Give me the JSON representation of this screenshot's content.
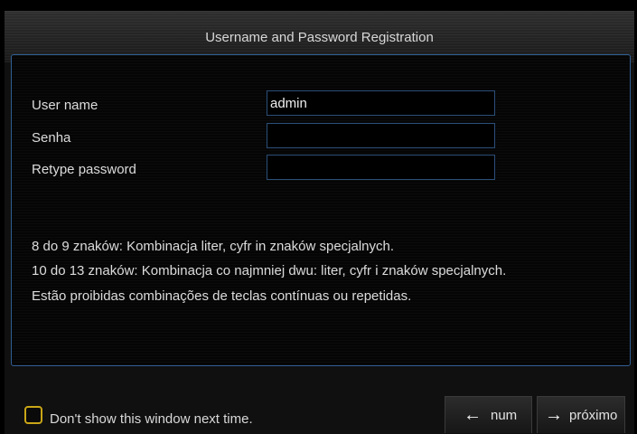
{
  "dialog": {
    "title": "Username and Password Registration"
  },
  "form": {
    "username_label": "User name",
    "username_value": "admin",
    "password_label": "Senha",
    "password_value": "",
    "retype_label": "Retype password",
    "retype_value": ""
  },
  "notes": [
    "8 do 9 znaków: Kombinacja liter, cyfr in znaków specjalnych.",
    "10 do 13 znaków: Kombinacja co najmniej dwu: liter, cyfr i znaków specjalnych.",
    "Estão proibidas combinações de teclas contínuas ou repetidas."
  ],
  "footer": {
    "dont_show_label": "Don't show this window next time.",
    "dont_show_checked": false,
    "prev_label": "num",
    "prev_icon": "arrow-left-icon",
    "next_label": "próximo",
    "next_icon": "arrow-right-icon"
  },
  "colors": {
    "checkbox_border": "#c9a617",
    "panel_border": "#2f5f93",
    "title_glow": "#3b8fe0"
  }
}
